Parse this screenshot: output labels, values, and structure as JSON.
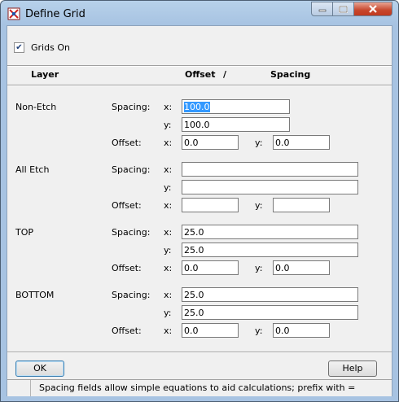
{
  "window": {
    "title": "Define Grid"
  },
  "grids_on": {
    "label": "Grids On",
    "checked": true
  },
  "headers": {
    "layer": "Layer",
    "offset": "Offset",
    "slash": "/",
    "spacing": "Spacing"
  },
  "field_labels": {
    "spacing": "Spacing:",
    "offset": "Offset:",
    "x": "x:",
    "y": "y:"
  },
  "layers": [
    {
      "name": "Non-Etch",
      "spacing_x": "100.0",
      "spacing_y": "100.0",
      "offset_x": "0.0",
      "offset_y": "0.0"
    },
    {
      "name": "All Etch",
      "spacing_x": "",
      "spacing_y": "",
      "offset_x": "",
      "offset_y": ""
    },
    {
      "name": "TOP",
      "spacing_x": "25.0",
      "spacing_y": "25.0",
      "offset_x": "0.0",
      "offset_y": "0.0"
    },
    {
      "name": "BOTTOM",
      "spacing_x": "25.0",
      "spacing_y": "25.0",
      "offset_x": "0.0",
      "offset_y": "0.0"
    }
  ],
  "buttons": {
    "ok": "OK",
    "help": "Help"
  },
  "status": "Spacing fields allow simple equations to aid calculations; prefix with ="
}
